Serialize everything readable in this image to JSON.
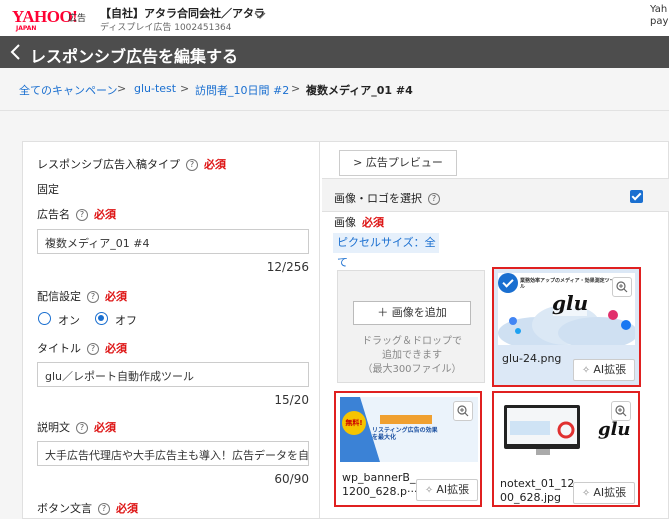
{
  "header": {
    "logo_text": "YAHOO!",
    "logo_sub": "JAPAN",
    "logo_ad": "広告",
    "account_name": "【自社】アタラ合同会社／アタラ",
    "account_sub": "ディスプレイ広告 1002451364",
    "user_line1": "Yah",
    "user_line2": "pay"
  },
  "title": {
    "text": "レスポンシブ広告を編集する"
  },
  "breadcrumb": {
    "items": [
      "全てのキャンペーン",
      "glu-test",
      "訪問者_10日間 #2"
    ],
    "current": "複数メディア_01 #4",
    "separator": ">"
  },
  "form": {
    "type_label": "レスポンシブ広告入稿タイプ",
    "type_value": "固定",
    "required": "必須",
    "help": "?",
    "name_label": "広告名",
    "name_value": "複数メディア_01 #4",
    "name_counter": "12/256",
    "delivery_label": "配信設定",
    "delivery_on": "オン",
    "delivery_off": "オフ",
    "title_label": "タイトル",
    "title_value": "glu／レポート自動作成ツール",
    "title_counter": "15/20",
    "desc_label": "説明文",
    "desc_value": "大手広告代理店や大手広告主も導入！広告データを自動で",
    "desc_counter": "60/90",
    "button_label": "ボタン文言"
  },
  "images": {
    "preview_label": "> 広告プレビュー",
    "select_label": "画像・ロゴを選択",
    "image_label": "画像",
    "pixel_size": "ピクセルサイズ：全て",
    "add_button": "＋ 画像を追加",
    "drop_line1": "ドラッグ＆ドロップで",
    "drop_line2": "追加できます",
    "drop_line3": "（最大300ファイル）",
    "ai_label": "AI拡張",
    "cards": [
      {
        "filename": "glu-24.png",
        "thumb_caption": "業務効率アップのメディア・効果測定ツール",
        "thumb_logo": "glu"
      },
      {
        "filename_1": "wp_bannerB_",
        "filename_2": "1200_628.p···",
        "thumb_badge": "無料!",
        "thumb_caption": "リスティング広告の効果を最大化"
      },
      {
        "filename_1": "notext_01_12",
        "filename_2": "00_628.jpg",
        "thumb_logo": "glu"
      }
    ]
  },
  "colors": {
    "accent": "#1a6fd0",
    "required": "#d11111",
    "highlight_border": "#e02020",
    "titlebar": "#4d4d4d"
  }
}
